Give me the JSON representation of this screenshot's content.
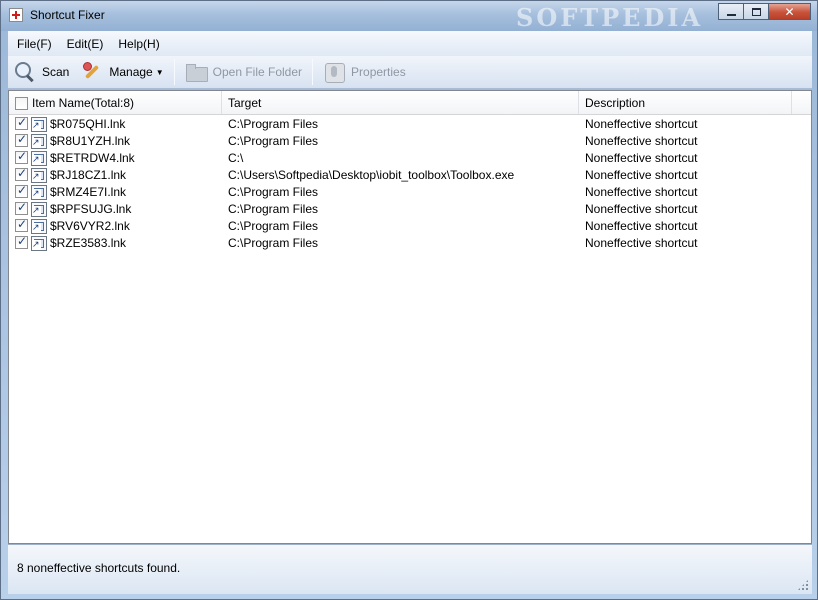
{
  "window": {
    "title": "Shortcut Fixer",
    "watermark": "SOFTPEDIA",
    "controls": {
      "minimize": "minimize",
      "maximize": "maximize",
      "close": "✕"
    }
  },
  "menubar": {
    "items": [
      {
        "label": "File(F)"
      },
      {
        "label": "Edit(E)"
      },
      {
        "label": "Help(H)"
      }
    ]
  },
  "toolbar": {
    "scan_label": "Scan",
    "manage_label": "Manage",
    "open_folder_label": "Open File Folder",
    "properties_label": "Properties"
  },
  "list": {
    "columns": {
      "name": "Item Name(Total:8)",
      "target": "Target",
      "description": "Description"
    },
    "header_checked": false,
    "rows": [
      {
        "checked": true,
        "name": "$R075QHI.lnk",
        "target": "C:\\Program Files",
        "description": "Noneffective shortcut"
      },
      {
        "checked": true,
        "name": "$R8U1YZH.lnk",
        "target": "C:\\Program Files",
        "description": "Noneffective shortcut"
      },
      {
        "checked": true,
        "name": "$RETRDW4.lnk",
        "target": "C:\\",
        "description": "Noneffective shortcut"
      },
      {
        "checked": true,
        "name": "$RJ18CZ1.lnk",
        "target": "C:\\Users\\Softpedia\\Desktop\\iobit_toolbox\\Toolbox.exe",
        "description": "Noneffective shortcut"
      },
      {
        "checked": true,
        "name": "$RMZ4E7I.lnk",
        "target": "C:\\Program Files",
        "description": "Noneffective shortcut"
      },
      {
        "checked": true,
        "name": "$RPFSUJG.lnk",
        "target": "C:\\Program Files",
        "description": "Noneffective shortcut"
      },
      {
        "checked": true,
        "name": "$RV6VYR2.lnk",
        "target": "C:\\Program Files",
        "description": "Noneffective shortcut"
      },
      {
        "checked": true,
        "name": "$RZE3583.lnk",
        "target": "C:\\Program Files",
        "description": "Noneffective shortcut"
      }
    ]
  },
  "status": {
    "text": "8 noneffective shortcuts found."
  },
  "colors": {
    "frame": "#9cb8d8",
    "close_button": "#c8523a",
    "disabled_text": "#8e97a3"
  }
}
